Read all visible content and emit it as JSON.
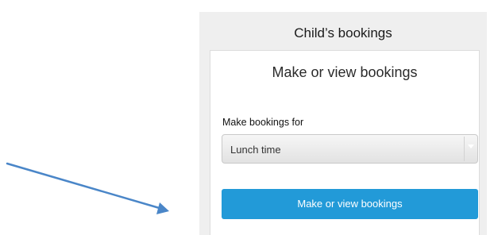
{
  "panel": {
    "title": "Child’s bookings"
  },
  "card": {
    "title": "Make or view bookings",
    "field_label": "Make bookings for",
    "select": {
      "value": "Lunch time"
    },
    "button_label": "Make or view bookings"
  },
  "annotation": {
    "arrow_color": "#4a86c8",
    "arrow_icon": "arrow-pointer-icon"
  },
  "colors": {
    "accent": "#229ad8",
    "panel_background": "#efefef"
  }
}
